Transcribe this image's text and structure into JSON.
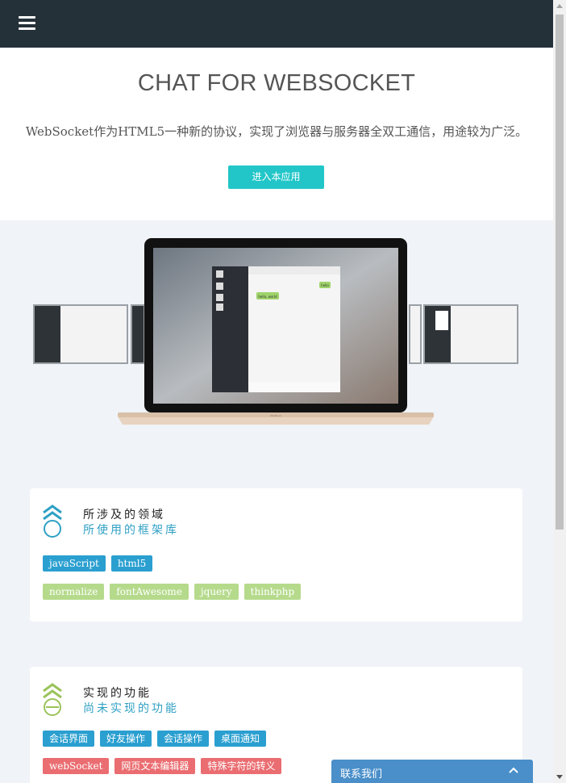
{
  "header": {
    "menu_icon": "hamburger-menu-icon"
  },
  "hero": {
    "title": "CHAT FOR WEBSOCKET",
    "description": "WebSocket作为HTML5一种新的协议，实现了浏览器与服务器全双工通信，用途较为广泛。",
    "enter_button": "进入本应用",
    "accent_color": "#23c6c8"
  },
  "showcase": {
    "image": "laptop-chat-app-preview",
    "mini_chat": {
      "left_bubble": "hello, world",
      "right_bubble": "hello",
      "laptop_brand": "MacBook"
    }
  },
  "domains_card": {
    "icon": "chevron-up-circle-icon",
    "title": "所涉及的领域",
    "subtitle": "所使用的框架库",
    "primary_tags": [
      "javaScript",
      "html5"
    ],
    "secondary_tags": [
      "normalize",
      "fontAwesome",
      "jquery",
      "thinkphp"
    ]
  },
  "features_card": {
    "icon": "chevron-up-circle-icon",
    "title": "实现的功能",
    "subtitle": "尚未实现的功能",
    "done_tags": [
      "会话界面",
      "好友操作",
      "会话操作",
      "桌面通知"
    ],
    "todo_tags": [
      "webSocket",
      "网页文本编辑器",
      "特殊字符的转义"
    ]
  },
  "contact": {
    "label": "联系我们",
    "icon": "chevron-up-icon"
  },
  "colors": {
    "topbar": "#253139",
    "tag_blue": "#2a9fd0",
    "tag_green": "#b5da8c",
    "tag_red": "#ea6d71",
    "contact_bar": "#4a8fc9"
  }
}
